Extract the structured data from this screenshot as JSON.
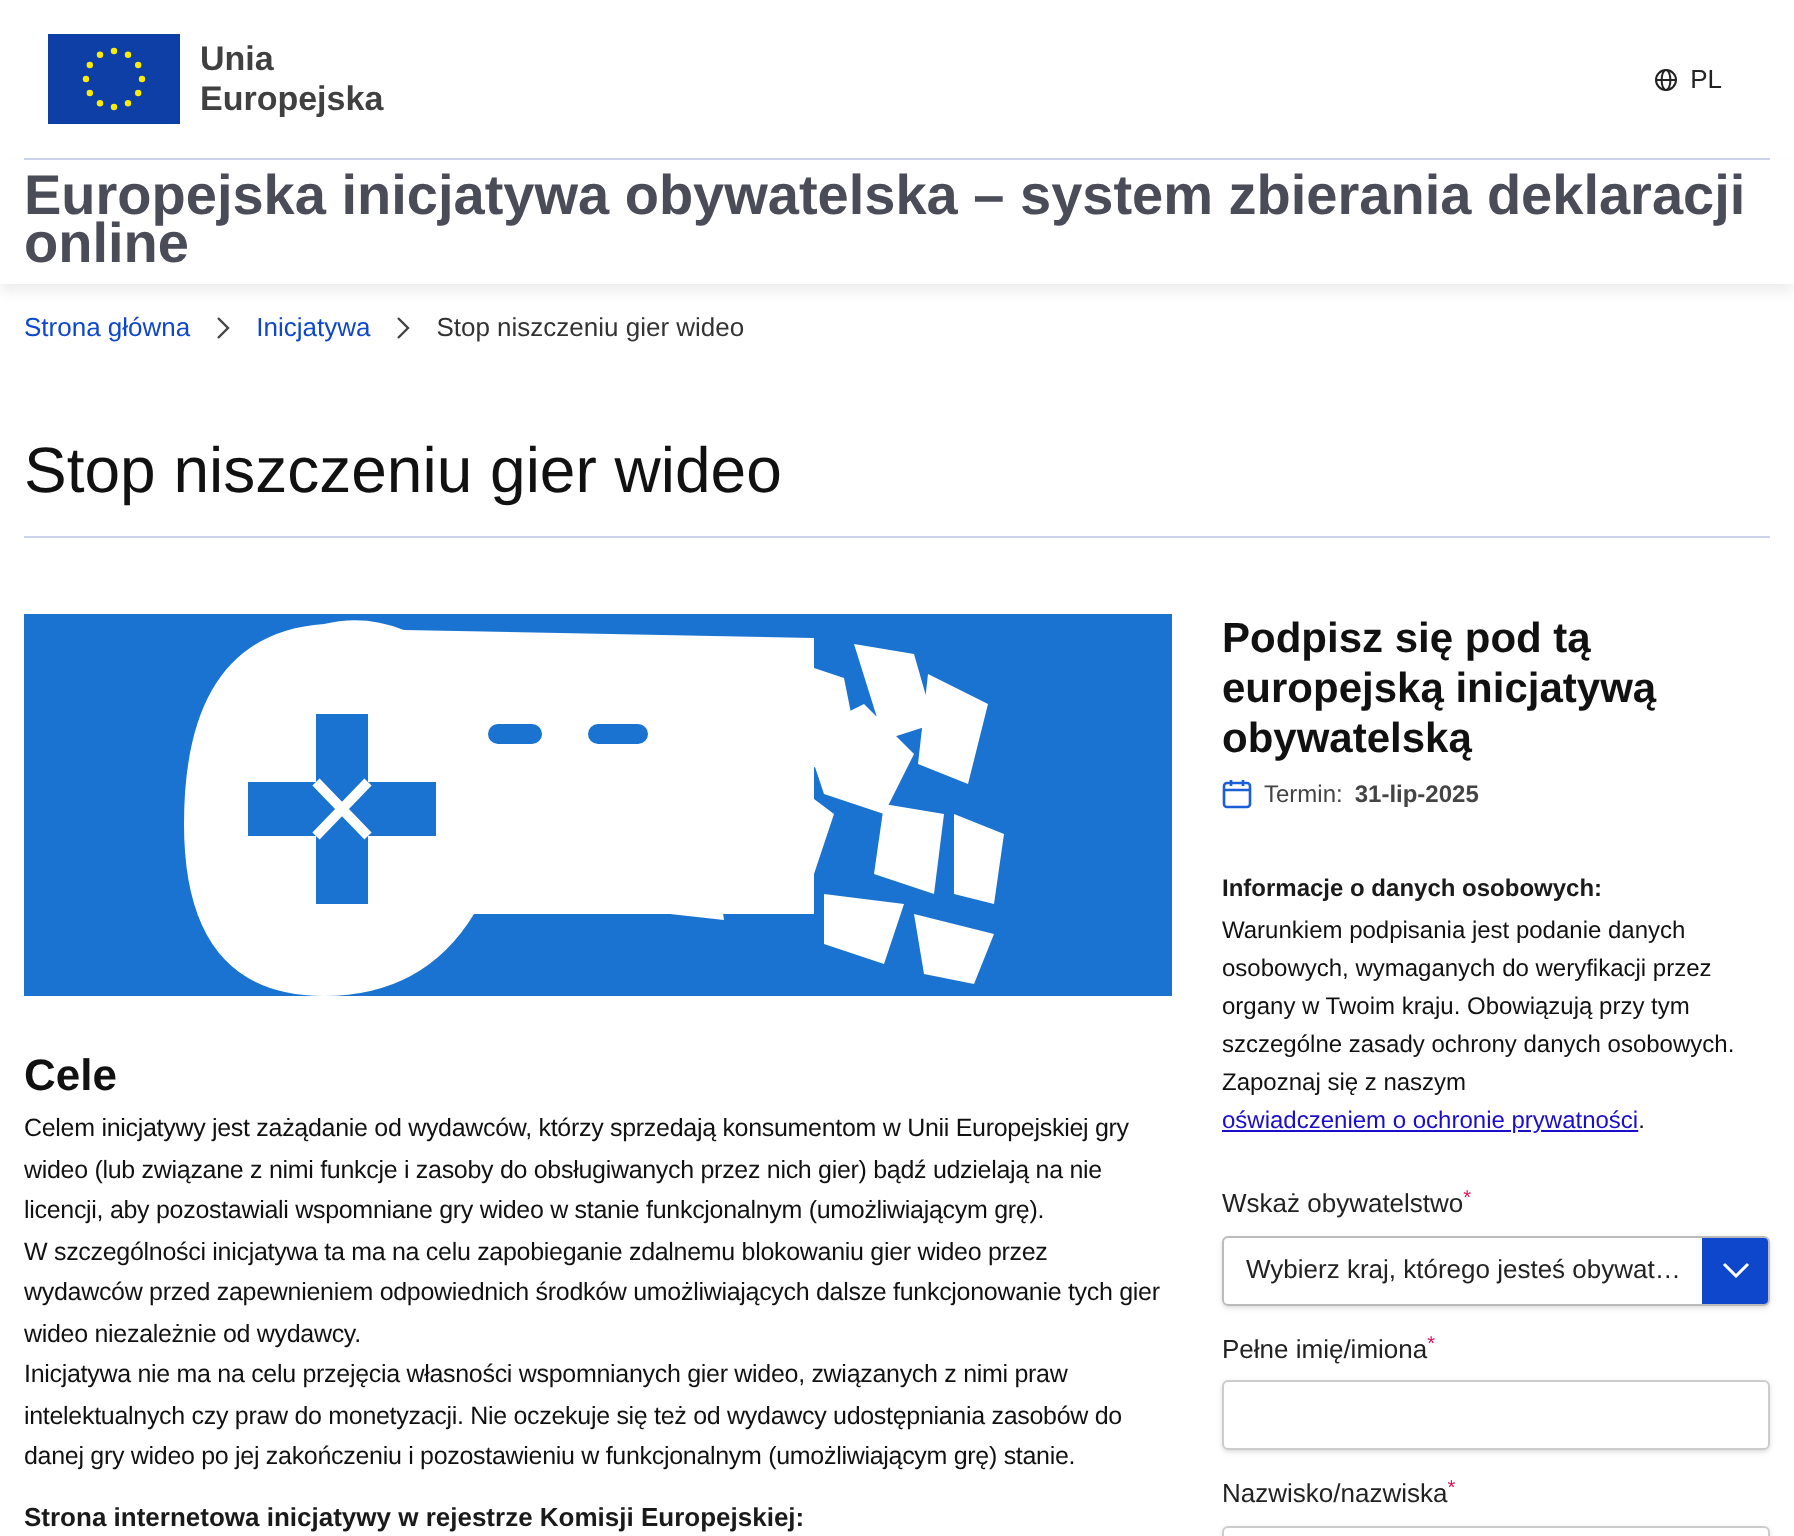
{
  "header": {
    "logo_text": [
      "Unia",
      "Europejska"
    ],
    "language": "PL"
  },
  "site_title": "Europejska inicjatywa obywatelska – system zbierania deklaracji online",
  "breadcrumb": [
    {
      "label": "Strona główna",
      "current": false
    },
    {
      "label": "Inicjatywa",
      "current": false
    },
    {
      "label": "Stop niszczeniu gier wideo",
      "current": true
    }
  ],
  "page_title": "Stop niszczeniu gier wideo",
  "goals": {
    "heading": "Cele",
    "paragraphs": [
      "Celem inicjatywy jest zażądanie od wydawców, którzy sprzedają konsumentom w Unii Europejskiej gry wideo (lub związane z nimi funkcje i zasoby do obsługiwanych przez nich gier) bądź udzielają na nie licencji, aby pozostawiali wspomniane gry wideo w stanie funkcjonalnym (umożliwiającym grę).",
      "W szczególności inicjatywa ta ma na celu zapobieganie zdalnemu blokowaniu gier wideo przez wydawców przed zapewnieniem odpowiednich środków umożliwiających dalsze funkcjonowanie tych gier wideo niezależnie od wydawcy.",
      "Inicjatywa nie ma na celu przejęcia własności wspomnianych gier wideo, związanych z nimi praw intelektualnych czy praw do monetyzacji. Nie oczekuje się też od wydawcy udostępniania zasobów do danej gry wideo po jej zakończeniu i pozostawieniu w funkcjonalnym (umożliwiającym grę) stanie."
    ],
    "register_heading": "Strona internetowa inicjatywy w rejestrze Komisji Europejskiej:"
  },
  "sign": {
    "heading": "Podpisz się pod tą europejską inicjatywą obywatelską",
    "deadline_label": "Termin:",
    "deadline": "31-lip-2025",
    "privacy_heading": "Informacje o danych osobowych:",
    "privacy_text": "Warunkiem podpisania jest podanie danych osobowych, wymaganych do weryfikacji przez organy w Twoim kraju. Obowiązują przy tym szczególne zasady ochrony danych osobowych. Zapoznaj się z naszym ",
    "privacy_link": "oświadczeniem o ochronie prywatności",
    "privacy_end": ".",
    "required_mark": "*",
    "fields": [
      {
        "kind": "select",
        "label": "Wskaż obywatelstwo",
        "required": true,
        "placeholder": "Wybierz kraj, którego jesteś obywat…"
      },
      {
        "kind": "text",
        "label": "Pełne imię/imiona",
        "required": true
      },
      {
        "kind": "text",
        "label": "Nazwisko/nazwiska",
        "required": true
      }
    ]
  }
}
